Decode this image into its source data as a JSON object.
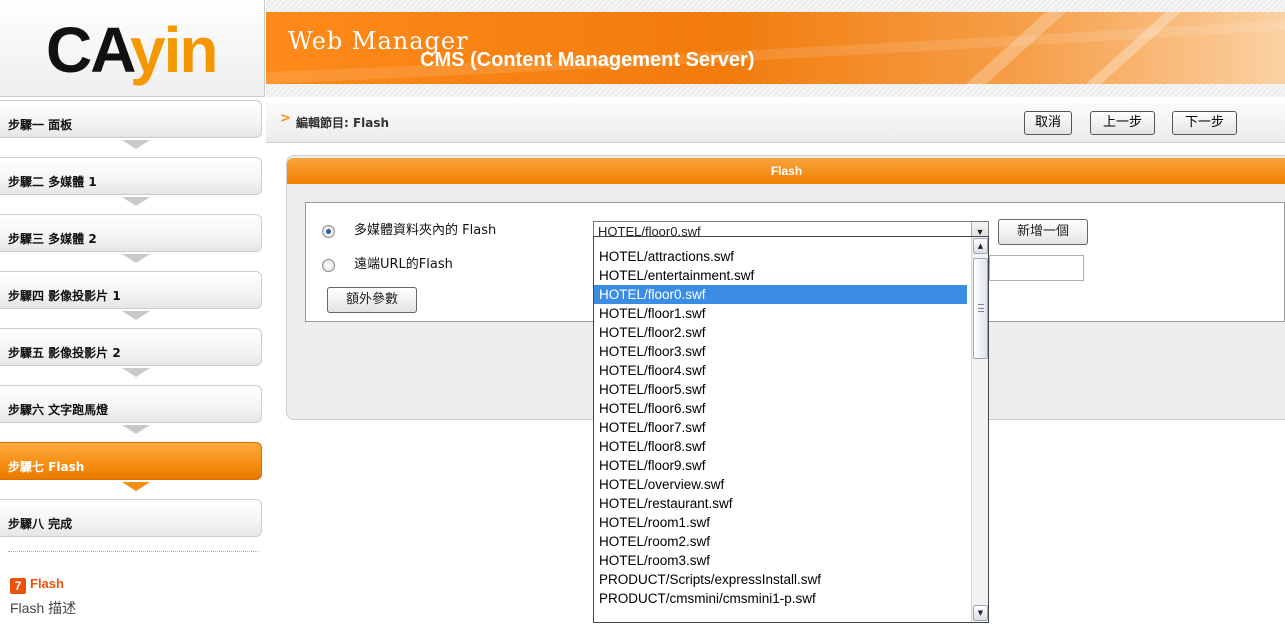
{
  "logo": {
    "text": "CAYIN",
    "color": "#f39800"
  },
  "header": {
    "subtitle": "Web Manager",
    "title": "CMS (Content Management Server)"
  },
  "steps": [
    {
      "label": "步驟一 面板",
      "active": false
    },
    {
      "label": "步驟二 多媒體 1",
      "active": false
    },
    {
      "label": "步驟三 多媒體 2",
      "active": false
    },
    {
      "label": "步驟四 影像投影片 1",
      "active": false
    },
    {
      "label": "步驟五 影像投影片 2",
      "active": false
    },
    {
      "label": "步驟六 文字跑馬燈",
      "active": false
    },
    {
      "label": "步驟七 Flash",
      "active": true
    },
    {
      "label": "步驟八 完成",
      "active": false
    }
  ],
  "flash_info": {
    "icon": "flash-icon",
    "icon_glyph": "7",
    "title": "Flash",
    "description": "Flash 描述"
  },
  "breadcrumb": {
    "arrow": ">",
    "text": "編輯節目: Flash"
  },
  "toolbar": {
    "cancel_label": "取消",
    "prev_label": "上一步",
    "next_label": "下一步"
  },
  "panel": {
    "title": "Flash",
    "radio_local_label": "多媒體資料夾內的 Flash",
    "radio_remote_label": "遠端URL的Flash",
    "selected_option": "local",
    "extra_button_label": "額外參數",
    "add_button_label": "新增一個",
    "select_value": "HOTEL/floor0.swf"
  },
  "dropdown": {
    "options": [
      "HOTEL/attractions.swf",
      "HOTEL/entertainment.swf",
      "HOTEL/floor0.swf",
      "HOTEL/floor1.swf",
      "HOTEL/floor2.swf",
      "HOTEL/floor3.swf",
      "HOTEL/floor4.swf",
      "HOTEL/floor5.swf",
      "HOTEL/floor6.swf",
      "HOTEL/floor7.swf",
      "HOTEL/floor8.swf",
      "HOTEL/floor9.swf",
      "HOTEL/overview.swf",
      "HOTEL/restaurant.swf",
      "HOTEL/room1.swf",
      "HOTEL/room2.swf",
      "HOTEL/room3.swf",
      "PRODUCT/Scripts/expressInstall.swf",
      "PRODUCT/cmsmini/cmsmini1-p.swf"
    ],
    "selected_index": 2,
    "scroll_up_glyph": "▲",
    "scroll_down_glyph": "▼"
  },
  "colors": {
    "accent": "#f48d10",
    "selection": "#3b8ce3",
    "flash_icon": "#e9540d"
  }
}
